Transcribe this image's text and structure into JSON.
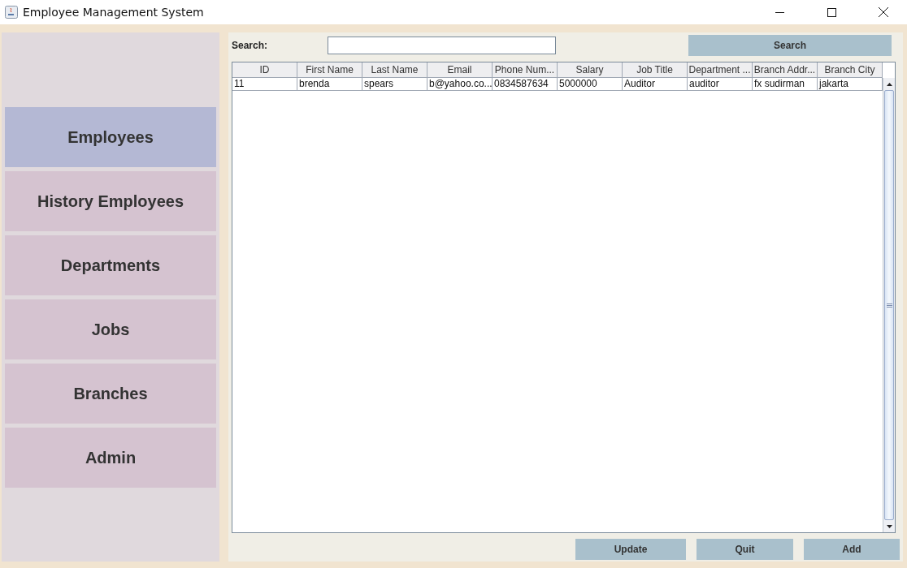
{
  "window": {
    "title": "Employee Management System"
  },
  "sidebar": {
    "items": [
      {
        "label": "Employees",
        "selected": true
      },
      {
        "label": "History Employees",
        "selected": false
      },
      {
        "label": "Departments",
        "selected": false
      },
      {
        "label": "Jobs",
        "selected": false
      },
      {
        "label": "Branches",
        "selected": false
      },
      {
        "label": "Admin",
        "selected": false
      }
    ]
  },
  "search": {
    "label": "Search:",
    "button": "Search"
  },
  "table": {
    "columns": [
      "ID",
      "First Name",
      "Last Name",
      "Email",
      "Phone Num...",
      "Salary",
      "Job Title",
      "Department ...",
      "Branch Addr...",
      "Branch City"
    ],
    "rows": [
      {
        "cells": [
          "11",
          "brenda",
          "spears",
          "b@yahoo.co...",
          "0834587634",
          "5000000",
          "Auditor",
          "auditor",
          "fx sudirman",
          "jakarta"
        ]
      }
    ]
  },
  "buttons": [
    "Update",
    "Quit",
    "Add"
  ]
}
